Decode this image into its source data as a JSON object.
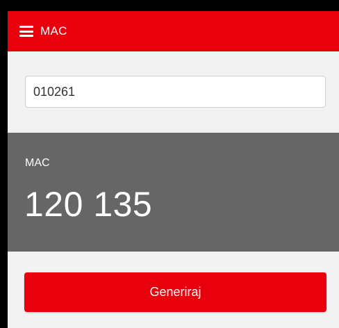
{
  "colors": {
    "accent": "#e8000d",
    "panel": "#666666",
    "background": "#f2f2f2"
  },
  "app_bar": {
    "menu_icon": "hamburger-menu-icon",
    "title": "MAC"
  },
  "input": {
    "value": "010261",
    "placeholder": ""
  },
  "result": {
    "label": "MAC",
    "value": "120 135"
  },
  "action": {
    "label": "Generiraj"
  }
}
